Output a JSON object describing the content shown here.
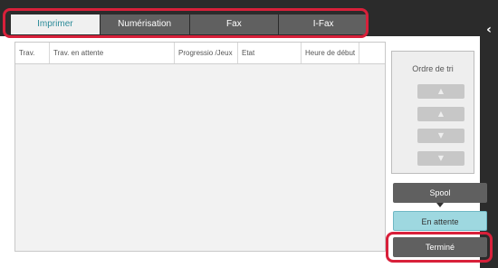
{
  "tabs": [
    {
      "label": "Imprimer",
      "active": true
    },
    {
      "label": "Numérisation",
      "active": false
    },
    {
      "label": "Fax",
      "active": false
    },
    {
      "label": "I-Fax",
      "active": false
    }
  ],
  "table": {
    "columns": [
      "Trav.",
      "Trav. en attente",
      "Progressio /Jeux",
      "Etat",
      "Heure de début"
    ],
    "rows": []
  },
  "sort_panel": {
    "title": "Ordre de tri",
    "buttons": [
      "▲",
      "▲",
      "▼",
      "▼"
    ]
  },
  "modes": {
    "spool": "Spool",
    "waiting": "En attente",
    "done": "Terminé"
  },
  "side": {
    "arrow": "‹"
  },
  "colors": {
    "highlight": "#d8203a",
    "active_tab_text": "#2a8a98",
    "waiting_button": "#9ed8e0",
    "dark": "#2b2b2b"
  }
}
